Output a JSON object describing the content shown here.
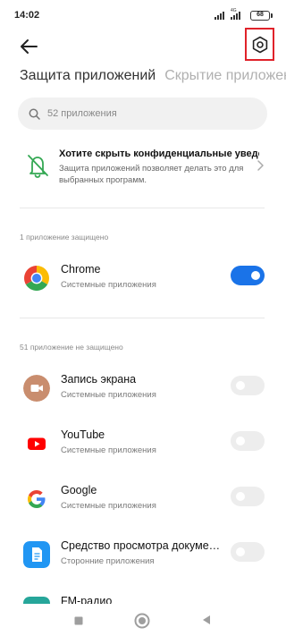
{
  "status_bar": {
    "time": "14:02",
    "network": "4G",
    "battery": "68"
  },
  "header": {
    "back_icon": "arrow-left-icon",
    "settings_icon": "gear-hexagon-icon",
    "highlight_color": "#e0222a"
  },
  "tabs": [
    {
      "label": "Защита приложений",
      "active": true
    },
    {
      "label": "Скрытие приложен",
      "active": false
    }
  ],
  "search": {
    "placeholder": "52 приложения",
    "value": ""
  },
  "banner": {
    "title": "Хотите скрыть конфиденциальные уведомления?",
    "text": "Защита приложений позволяет делать это для выбранных программ.",
    "icon": "bell-slash-icon",
    "accent": "#34a853"
  },
  "protected_section": {
    "label": "1 приложение защищено",
    "apps": [
      {
        "name": "Chrome",
        "category": "Системные приложения",
        "enabled": true,
        "icon": "chrome-icon"
      }
    ]
  },
  "unprotected_section": {
    "label": "51 приложение не защищено",
    "apps": [
      {
        "name": "Запись экрана",
        "category": "Системные приложения",
        "enabled": false,
        "icon": "screen-recorder-icon"
      },
      {
        "name": "YouTube",
        "category": "Системные приложения",
        "enabled": false,
        "icon": "youtube-icon"
      },
      {
        "name": "Google",
        "category": "Системные приложения",
        "enabled": false,
        "icon": "google-icon"
      },
      {
        "name": "Средство просмотра докуме…",
        "category": "Сторонние приложения",
        "enabled": false,
        "icon": "document-viewer-icon"
      },
      {
        "name": "FM-радио",
        "category": "",
        "enabled": false,
        "icon": "fm-radio-icon"
      }
    ]
  },
  "colors": {
    "toggle_on": "#1a73e8",
    "toggle_off": "#ededed"
  },
  "nav_bar": {
    "recents_icon": "square-icon",
    "home_icon": "circle-icon",
    "back_icon": "triangle-icon"
  }
}
